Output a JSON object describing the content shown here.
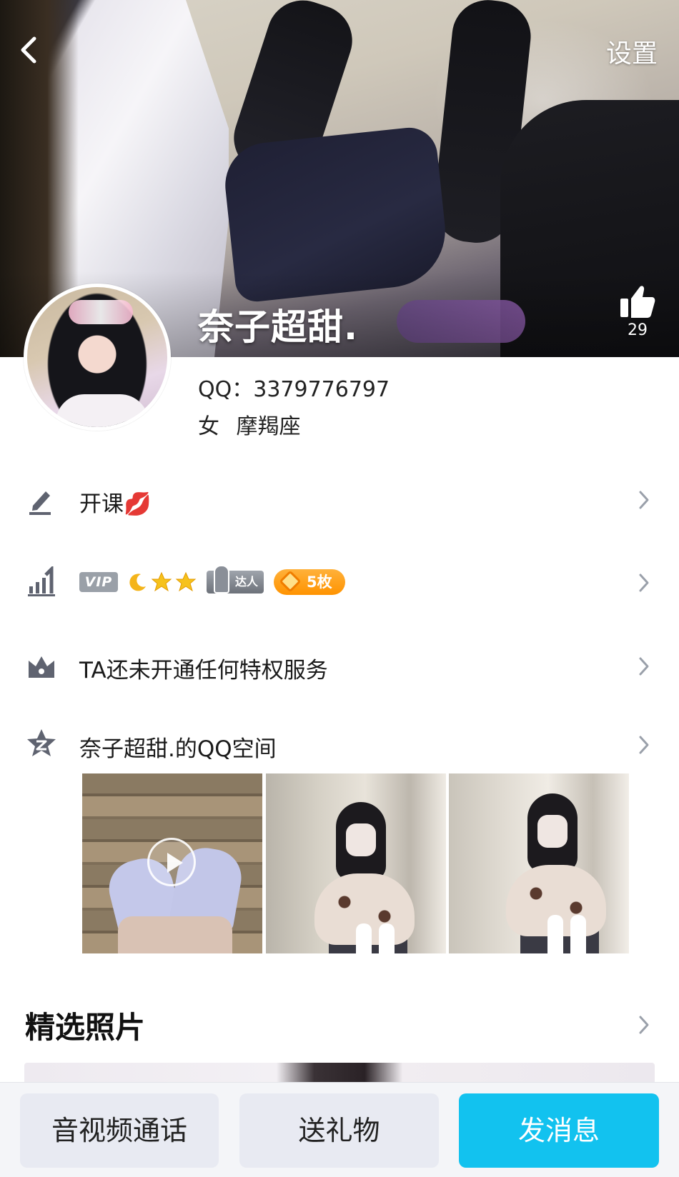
{
  "header": {
    "settings_label": "设置",
    "likes": "29"
  },
  "profile": {
    "nickname": "奈子超甜.",
    "qq_line": "QQ：3379776797",
    "gender": "女",
    "zodiac": "摩羯座"
  },
  "rows": {
    "signature": "开课",
    "signature_emoji": "💋",
    "vip_badge": "VIP",
    "medal_badge": "5枚",
    "daren_badge": "达人",
    "privilege": "TA还未开通任何特权服务",
    "qzone": "奈子超甜.的QQ空间"
  },
  "featured": {
    "title": "精选照片"
  },
  "bottom_bar": {
    "call": "音视频通话",
    "gift": "送礼物",
    "message": "发消息"
  },
  "colors": {
    "accent": "#12c2ef",
    "medal": "#ff9f1c",
    "icon_gray": "#5f6370"
  }
}
